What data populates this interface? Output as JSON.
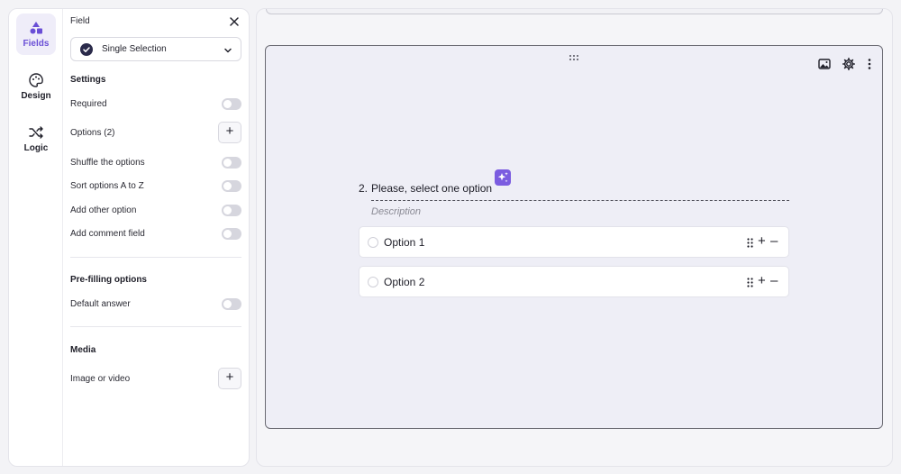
{
  "rail": {
    "fields_label": "Fields",
    "design_label": "Design",
    "logic_label": "Logic"
  },
  "panel": {
    "title": "Field",
    "field_type": "Single Selection",
    "settings_title": "Settings",
    "required_label": "Required",
    "options_label": "Options (2)",
    "shuffle_label": "Shuffle the options",
    "sort_label": "Sort options A to Z",
    "add_other_label": "Add other option",
    "add_comment_label": "Add comment field",
    "prefill_title": "Pre-filling options",
    "default_answer_label": "Default answer",
    "media_title": "Media",
    "media_label": "Image or video",
    "plus_glyph": "+"
  },
  "toggles": {
    "required": false,
    "shuffle": false,
    "sort": false,
    "add_other": false,
    "add_comment": false,
    "default_answer": false
  },
  "question": {
    "number": "2.",
    "title": "Please, select one option",
    "description_placeholder": "Description",
    "options": [
      {
        "label": "Option 1"
      },
      {
        "label": "Option 2"
      }
    ],
    "add_glyph": "+",
    "remove_glyph": "–"
  },
  "colors": {
    "accent": "#6a4fd6",
    "ai_badge": "#7b5ce0",
    "toggle_off": "#d6d6de"
  }
}
